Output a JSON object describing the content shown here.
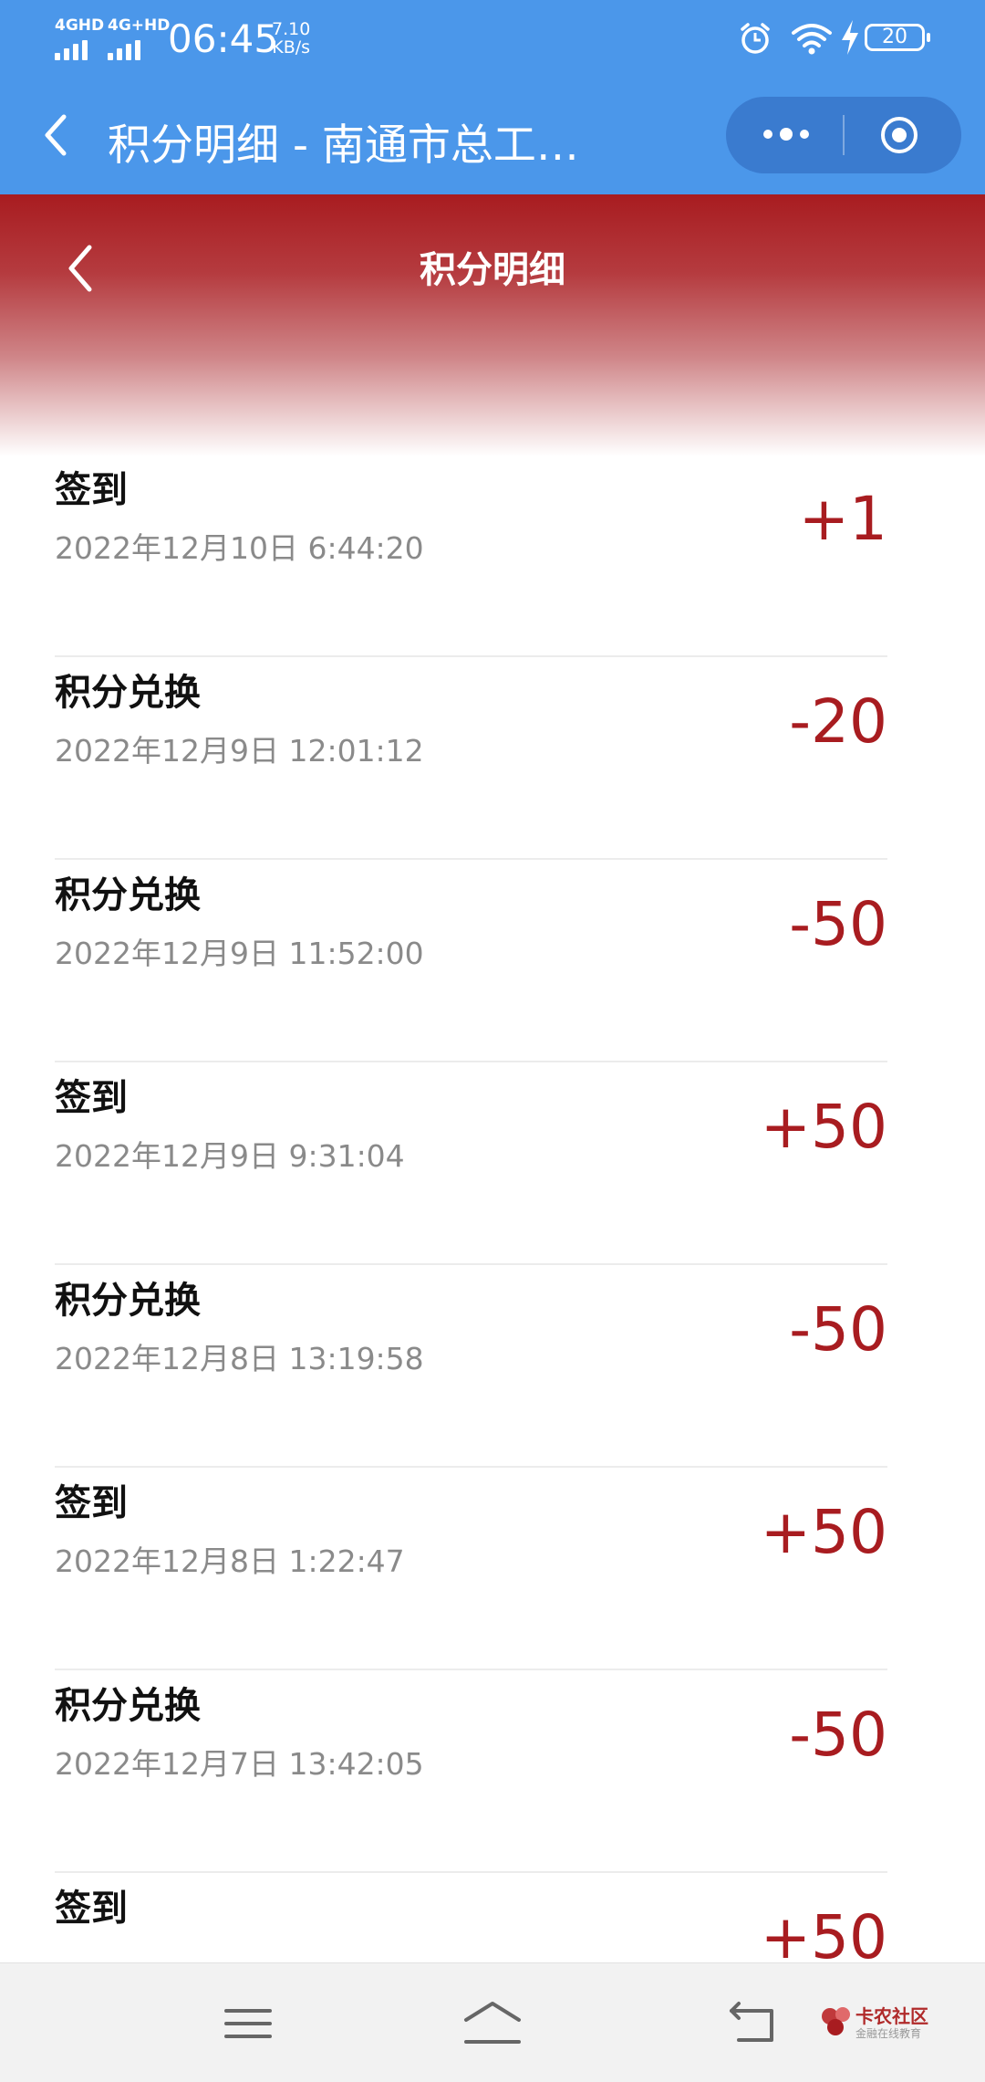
{
  "status_bar": {
    "signal_1": "4GHD",
    "signal_2": "4G+HD",
    "time": "06:45",
    "speed_value": "7.10",
    "speed_unit": "KB/s",
    "battery": "20"
  },
  "miniprogram_bar": {
    "title": "积分明细 - 南通市总工…"
  },
  "header": {
    "title": "积分明细"
  },
  "records": [
    {
      "title": "签到",
      "time": "2022年12月10日 6:44:20",
      "amount": "+1"
    },
    {
      "title": "积分兑换",
      "time": "2022年12月9日 12:01:12",
      "amount": "-20"
    },
    {
      "title": "积分兑换",
      "time": "2022年12月9日 11:52:00",
      "amount": "-50"
    },
    {
      "title": "签到",
      "time": "2022年12月9日 9:31:04",
      "amount": "+50"
    },
    {
      "title": "积分兑换",
      "time": "2022年12月8日 13:19:58",
      "amount": "-50"
    },
    {
      "title": "签到",
      "time": "2022年12月8日 1:22:47",
      "amount": "+50"
    },
    {
      "title": "积分兑换",
      "time": "2022年12月7日 13:42:05",
      "amount": "-50"
    },
    {
      "title": "签到",
      "time": "",
      "amount": "+50"
    }
  ],
  "watermark": {
    "name": "卡农社区",
    "sub": "金融在线教育"
  },
  "colors": {
    "topbar": "#4b97ea",
    "header_red": "#a81c20",
    "amount_red": "#a81c20"
  }
}
